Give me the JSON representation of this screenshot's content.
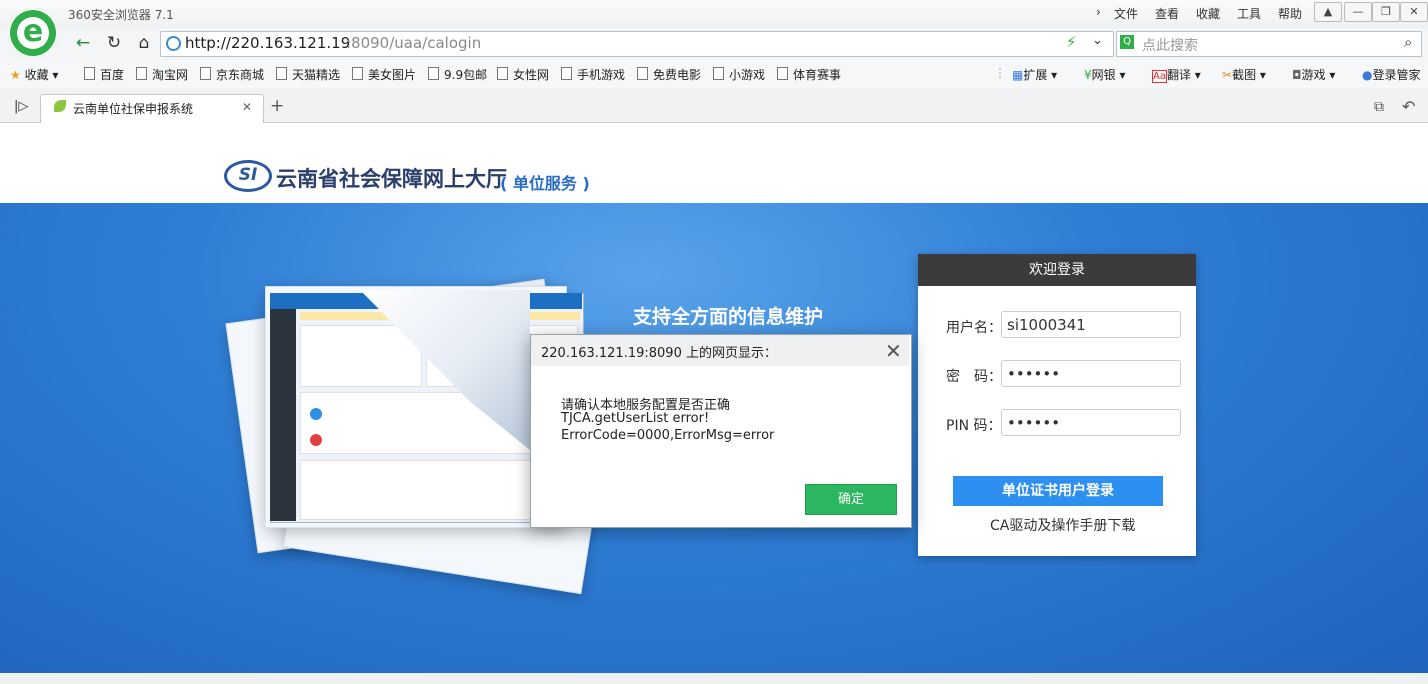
{
  "browser": {
    "title": "360安全浏览器 7.1",
    "menu": [
      "文件",
      "查看",
      "收藏",
      "工具",
      "帮助"
    ],
    "url_host": "http://220.163.121.19",
    "url_rest": ":8090/uaa/calogin",
    "search_placeholder": "点此搜索",
    "bookmarks_label": "收藏",
    "bookmarks": [
      "百度",
      "淘宝网",
      "京东商城",
      "天猫精选",
      "美女图片",
      "9.9包邮",
      "女性网",
      "手机游戏",
      "免费电影",
      "小游戏",
      "体育赛事"
    ],
    "tools": [
      "扩展",
      "网银",
      "翻译",
      "截图",
      "游戏",
      "登录管家"
    ],
    "tab_title": "云南单位社保申报系统",
    "new_tab": "+"
  },
  "site": {
    "logo_text": "SI",
    "title": "云南省社会保障网上大厅",
    "subtitle": "( 单位服务 )",
    "slogan": "支持全方面的信息维护"
  },
  "login": {
    "header": "欢迎登录",
    "username_label": "用户名：",
    "username_value": "si1000341",
    "password_label": "密　码：",
    "password_value": "••••••",
    "pin_label": "PIN 码：",
    "pin_value": "••••••",
    "submit": "单位证书用户登录",
    "ca_link": "CA驱动及操作手册下载"
  },
  "dialog": {
    "title": "220.163.121.19:8090 上的网页显示：",
    "lines": [
      "请确认本地服务配置是否正确",
      "TJCA.getUserList error!",
      "ErrorCode=0000,ErrorMsg=error"
    ],
    "ok": "确定"
  },
  "colors": {
    "banner": "#2f7fd6",
    "ok_button": "#2db660",
    "login_button": "#2d8ff0"
  }
}
